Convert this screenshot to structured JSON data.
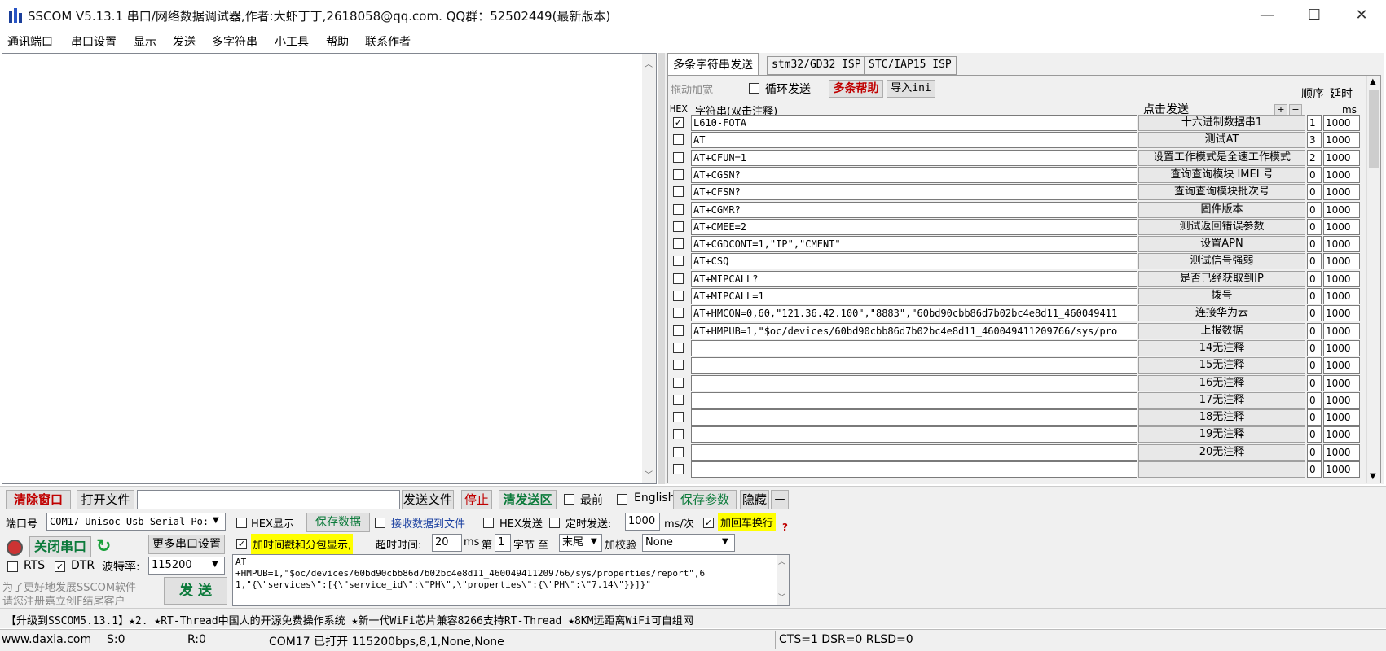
{
  "window": {
    "title": "SSCOM V5.13.1 串口/网络数据调试器,作者:大虾丁丁,2618058@qq.com. QQ群：52502449(最新版本)",
    "min": "—",
    "max": "☐",
    "close": "✕"
  },
  "menu": [
    "通讯端口",
    "串口设置",
    "显示",
    "发送",
    "多字符串",
    "小工具",
    "帮助",
    "联系作者"
  ],
  "multi": {
    "tabs": [
      "多条字符串发送",
      "stm32/GD32 ISP",
      "STC/IAP15 ISP"
    ],
    "drag_label": "拖动加宽",
    "loop_label": "循环发送",
    "help_label": "多条帮助",
    "import_label": "导入ini",
    "order_label": "顺序",
    "delay_label": "延时",
    "hex_header": "HEX",
    "string_header": "字符串(双击注释)",
    "click_header": "点击发送",
    "plus": "+",
    "minus": "−",
    "ms_label": "ms",
    "rows": [
      {
        "checked": true,
        "text": "L610-FOTA",
        "button": "十六进制数据串1",
        "order": "1",
        "delay": "1000"
      },
      {
        "checked": false,
        "text": "AT",
        "button": "测试AT",
        "order": "3",
        "delay": "1000"
      },
      {
        "checked": false,
        "text": "AT+CFUN=1",
        "button": "设置工作模式是全速工作模式",
        "order": "2",
        "delay": "1000"
      },
      {
        "checked": false,
        "text": "AT+CGSN?",
        "button": "查询查询模块 IMEI 号",
        "order": "0",
        "delay": "1000"
      },
      {
        "checked": false,
        "text": "AT+CFSN?",
        "button": "查询查询模块批次号",
        "order": "0",
        "delay": "1000"
      },
      {
        "checked": false,
        "text": "AT+CGMR?",
        "button": "固件版本",
        "order": "0",
        "delay": "1000"
      },
      {
        "checked": false,
        "text": "AT+CMEE=2",
        "button": "测试返回错误参数",
        "order": "0",
        "delay": "1000"
      },
      {
        "checked": false,
        "text": "AT+CGDCONT=1,\"IP\",\"CMENT\"",
        "button": "设置APN",
        "order": "0",
        "delay": "1000"
      },
      {
        "checked": false,
        "text": "AT+CSQ",
        "button": "测试信号强弱",
        "order": "0",
        "delay": "1000"
      },
      {
        "checked": false,
        "text": "AT+MIPCALL?",
        "button": "是否已经获取到IP",
        "order": "0",
        "delay": "1000"
      },
      {
        "checked": false,
        "text": "AT+MIPCALL=1",
        "button": "拨号",
        "order": "0",
        "delay": "1000"
      },
      {
        "checked": false,
        "text": "AT+HMCON=0,60,\"121.36.42.100\",\"8883\",\"60bd90cbb86d7b02bc4e8d11_460049411",
        "button": "连接华为云",
        "order": "0",
        "delay": "1000"
      },
      {
        "checked": false,
        "text": "AT+HMPUB=1,\"$oc/devices/60bd90cbb86d7b02bc4e8d11_460049411209766/sys/pro",
        "button": "上报数据",
        "order": "0",
        "delay": "1000"
      },
      {
        "checked": false,
        "text": "",
        "button": "14无注释",
        "order": "0",
        "delay": "1000"
      },
      {
        "checked": false,
        "text": "",
        "button": "15无注释",
        "order": "0",
        "delay": "1000"
      },
      {
        "checked": false,
        "text": "",
        "button": "16无注释",
        "order": "0",
        "delay": "1000"
      },
      {
        "checked": false,
        "text": "",
        "button": "17无注释",
        "order": "0",
        "delay": "1000"
      },
      {
        "checked": false,
        "text": "",
        "button": "18无注释",
        "order": "0",
        "delay": "1000"
      },
      {
        "checked": false,
        "text": "",
        "button": "19无注释",
        "order": "0",
        "delay": "1000"
      },
      {
        "checked": false,
        "text": "",
        "button": "20无注释",
        "order": "0",
        "delay": "1000"
      },
      {
        "checked": false,
        "text": "",
        "button": "",
        "order": "0",
        "delay": "1000"
      }
    ]
  },
  "toolbar": {
    "clear": "清除窗口",
    "open_file": "打开文件",
    "send_file": "发送文件",
    "stop": "停止",
    "clear_send": "清发送区",
    "topmost": "最前",
    "english": "English",
    "save_params": "保存参数",
    "hide": "隐藏",
    "dash": "—"
  },
  "port": {
    "port_label": "端口号",
    "port_value": "COM17 Unisoc Usb Serial Po:",
    "close_port": "关闭串口",
    "more_settings": "更多串口设置",
    "rts": "RTS",
    "dtr": "DTR",
    "baud_label": "波特率:",
    "baud_value": "115200",
    "promo1": "为了更好地发展SSCOM软件",
    "promo2": "请您注册嘉立创F结尾客户",
    "send": "发 送"
  },
  "options": {
    "hex_show": "HEX显示",
    "save_data": "保存数据",
    "recv_to_file": "接收数据到文件",
    "hex_send": "HEX发送",
    "timed_send": "定时发送:",
    "interval": "1000",
    "interval_unit": "ms/次",
    "add_crlf": "加回车换行",
    "timestamp": "加时间戳和分包显示,",
    "timeout_label": "超时时间:",
    "timeout": "20",
    "ms": "ms",
    "di": "第",
    "byte_no": "1",
    "byte_label": "字节 至",
    "tail": "末尾",
    "checksum_label": "加校验",
    "checksum": "None",
    "q": "?"
  },
  "send_text": [
    "AT",
    "+HMPUB=1,\"$oc/devices/60bd90cbb86d7b02bc4e8d11_460049411209766/sys/properties/report\",6",
    "1,\"{\\\"services\\\":[{\\\"service_id\\\":\\\"PH\\\",\\\"properties\\\":{\\\"PH\\\":\\\"7.14\\\"}}]}\""
  ],
  "ticker": "【升级到SSCOM5.13.1】★2. ★RT-Thread中国人的开源免费操作系统 ★新一代WiFi芯片兼容8266支持RT-Thread ★8KM远距离WiFi可自组网",
  "status": {
    "site": "www.daxia.com",
    "s": "S:0",
    "r": "R:0",
    "port_state": "COM17 已打开  115200bps,8,1,None,None",
    "lines": "CTS=1 DSR=0 RLSD=0"
  }
}
